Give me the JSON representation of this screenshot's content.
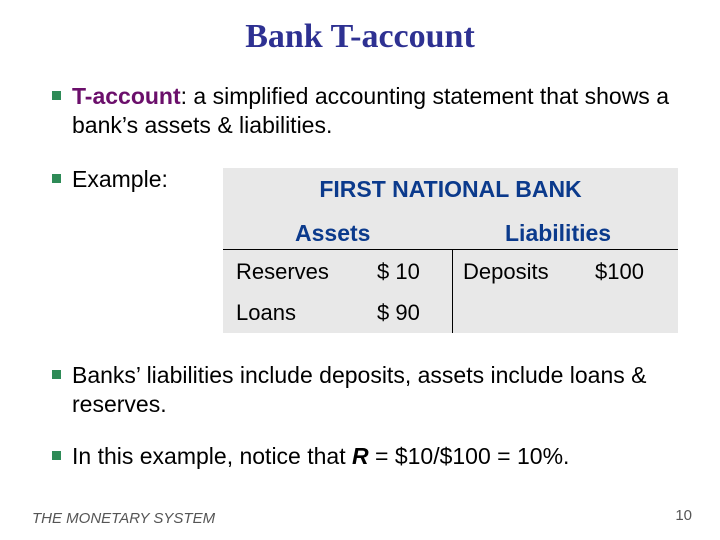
{
  "title": "Bank T-account",
  "bullets": [
    {
      "term": "T-account",
      "text": ":  a simplified accounting statement that shows a bank’s assets & liabilities."
    },
    {
      "text": "Example:"
    },
    {
      "text": "Banks’ liabilities include deposits, assets include loans & reserves."
    },
    {
      "prefix": "In this example, notice that ",
      "var": "R",
      "suffix": " = $10/$100 = 10%."
    }
  ],
  "t_account": {
    "bank_name": "FIRST NATIONAL BANK",
    "assets_header": "Assets",
    "liabilities_header": "Liabilities",
    "assets": [
      {
        "name": "Reserves",
        "amount": "$ 10"
      },
      {
        "name": "Loans",
        "amount": "$ 90"
      }
    ],
    "liabilities": [
      {
        "name": "Deposits",
        "amount": "$100"
      }
    ]
  },
  "footer": {
    "section": "THE MONETARY SYSTEM",
    "page_number": "10"
  },
  "colors": {
    "title": "#2e3192",
    "term": "#6b0f6b",
    "table_header": "#0b3a8c",
    "bullet": "#2e8b57",
    "table_bg": "#e8e8e8"
  }
}
